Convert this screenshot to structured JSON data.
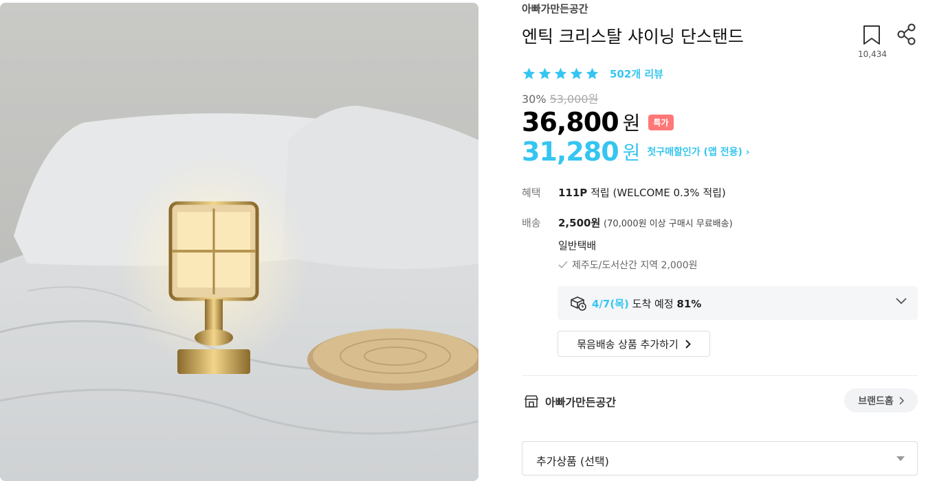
{
  "product": {
    "brand": "아빠가만든공간",
    "title": "엔틱 크리스탈 샤이닝 단스탠드",
    "bookmark_count": "10,434",
    "rating": 5,
    "reviews_label": "502개 리뷰",
    "discount_rate": "30%",
    "original_price": "53,000원",
    "price": "36,800",
    "price_unit": "원",
    "special_badge": "특가",
    "app_price": "31,280",
    "app_price_unit": "원",
    "app_price_link": "첫구매할인가 (앱 전용) ›"
  },
  "benefit": {
    "label": "혜택",
    "points": "111P",
    "points_text": "적립 (WELCOME 0.3% 적립)"
  },
  "shipping": {
    "label": "배송",
    "fee": "2,500원",
    "free_note": "(70,000원 이상 구매시 무료배송)",
    "method": "일반택배",
    "jeju_note": "제주도/도서산간 지역 2,000원",
    "arrival_date": "4/7(목)",
    "arrival_text": "도착 예정",
    "arrival_rate": "81%",
    "bundle_button": "묶음배송 상품 추가하기"
  },
  "store": {
    "name": "아빠가만든공간",
    "home_button": "브랜드홈"
  },
  "addon_select": {
    "selected": "추가상품 (선택)"
  },
  "colors": {
    "accent": "#35c5f0",
    "badge": "#ff7777"
  }
}
